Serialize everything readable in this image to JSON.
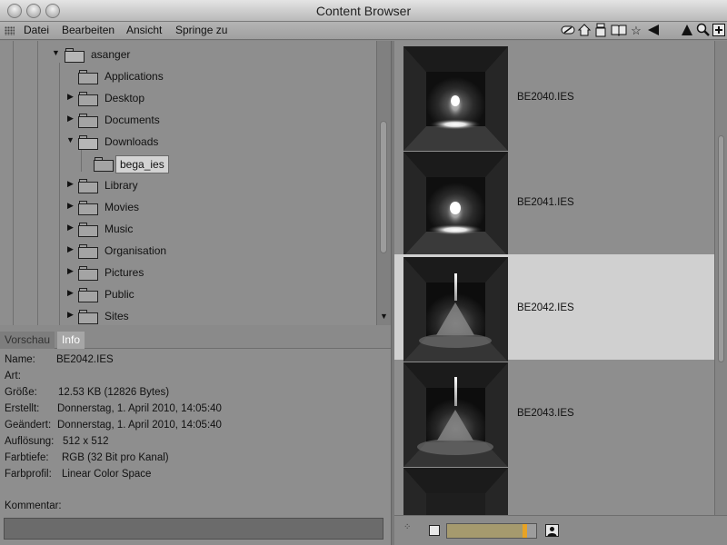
{
  "window": {
    "title": "Content Browser"
  },
  "menu": {
    "items": [
      "Datei",
      "Bearbeiten",
      "Ansicht",
      "Springe zu"
    ]
  },
  "toolbar": {
    "icons": [
      "link-icon",
      "home-icon",
      "database-icon",
      "book-icon",
      "star-icon",
      "back-arrow-icon",
      "up-arrow-icon",
      "search-icon",
      "add-icon"
    ]
  },
  "tree": {
    "root": "asanger",
    "items": [
      {
        "label": "Applications",
        "expandable": false
      },
      {
        "label": "Desktop",
        "expandable": true
      },
      {
        "label": "Documents",
        "expandable": true
      },
      {
        "label": "Downloads",
        "expandable": true,
        "expanded": true
      },
      {
        "label": "bega_ies",
        "expandable": false,
        "child": true,
        "selected": true
      },
      {
        "label": "Library",
        "expandable": true
      },
      {
        "label": "Movies",
        "expandable": true
      },
      {
        "label": "Music",
        "expandable": true
      },
      {
        "label": "Organisation",
        "expandable": true
      },
      {
        "label": "Pictures",
        "expandable": true
      },
      {
        "label": "Public",
        "expandable": true
      },
      {
        "label": "Sites",
        "expandable": true
      }
    ]
  },
  "tabs": {
    "preview": "Vorschau",
    "info": "Info",
    "active": "Info"
  },
  "info": {
    "rows": [
      {
        "label": "Name:",
        "value": "BE2042.IES"
      },
      {
        "label": "Art:",
        "value": ""
      },
      {
        "label": "Größe:",
        "value": "12.53 KB (12826 Bytes)"
      },
      {
        "label": "Erstellt:",
        "value": "Donnerstag, 1. April 2010, 14:05:40"
      },
      {
        "label": "Geändert:",
        "value": "Donnerstag, 1. April 2010, 14:05:40"
      },
      {
        "label": "Auflösung:",
        "value": "512 x 512"
      },
      {
        "label": "Farbtiefe:",
        "value": "RGB (32 Bit pro Kanal)"
      },
      {
        "label": "Farbprofil:",
        "value": "Linear Color Space"
      }
    ],
    "comment_label": "Kommentar:",
    "comment_value": ""
  },
  "files": [
    {
      "name": "BE2040.IES",
      "selected": false
    },
    {
      "name": "BE2041.IES",
      "selected": false
    },
    {
      "name": "BE2042.IES",
      "selected": true
    },
    {
      "name": "BE2043.IES",
      "selected": false
    },
    {
      "name": "",
      "selected": false
    }
  ],
  "zoom": {
    "level": 0.9
  },
  "colors": {
    "selection": "#d0d0d0",
    "slider_handle": "#e7a325",
    "panel": "#8e8e8e"
  }
}
